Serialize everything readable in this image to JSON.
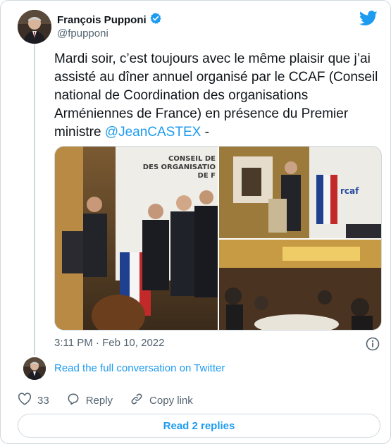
{
  "author": {
    "name": "François Pupponi",
    "handle": "@fpupponi"
  },
  "tweet": {
    "text_before": "Mardi soir, c’est toujours avec le même plaisir que j’ai assisté au dîner annuel organisé par le CCAF (Conseil national de Coordination des organisations Arméniennes de France) en présence du Premier ministre ",
    "mention": "@JeanCASTEX",
    "text_after": " -",
    "timestamp": "3:11 PM · Feb 10, 2022"
  },
  "media": {
    "sign_line1": "CONSEIL DE",
    "sign_line2": "DES ORGANISATIO",
    "sign_line3": "DE F",
    "logo_text": "rcaf"
  },
  "links": {
    "read_full": "Read the full conversation on Twitter"
  },
  "actions": {
    "likes": "33",
    "reply": "Reply",
    "copy_link": "Copy link"
  },
  "replies_button": "Read 2 replies",
  "colors": {
    "accent": "#1d9bf0",
    "secondary_text": "#536471",
    "border": "#cfd9de"
  },
  "icons": [
    "twitter-logo-icon",
    "verified-badge-icon",
    "info-icon",
    "heart-icon",
    "reply-icon",
    "link-icon"
  ]
}
